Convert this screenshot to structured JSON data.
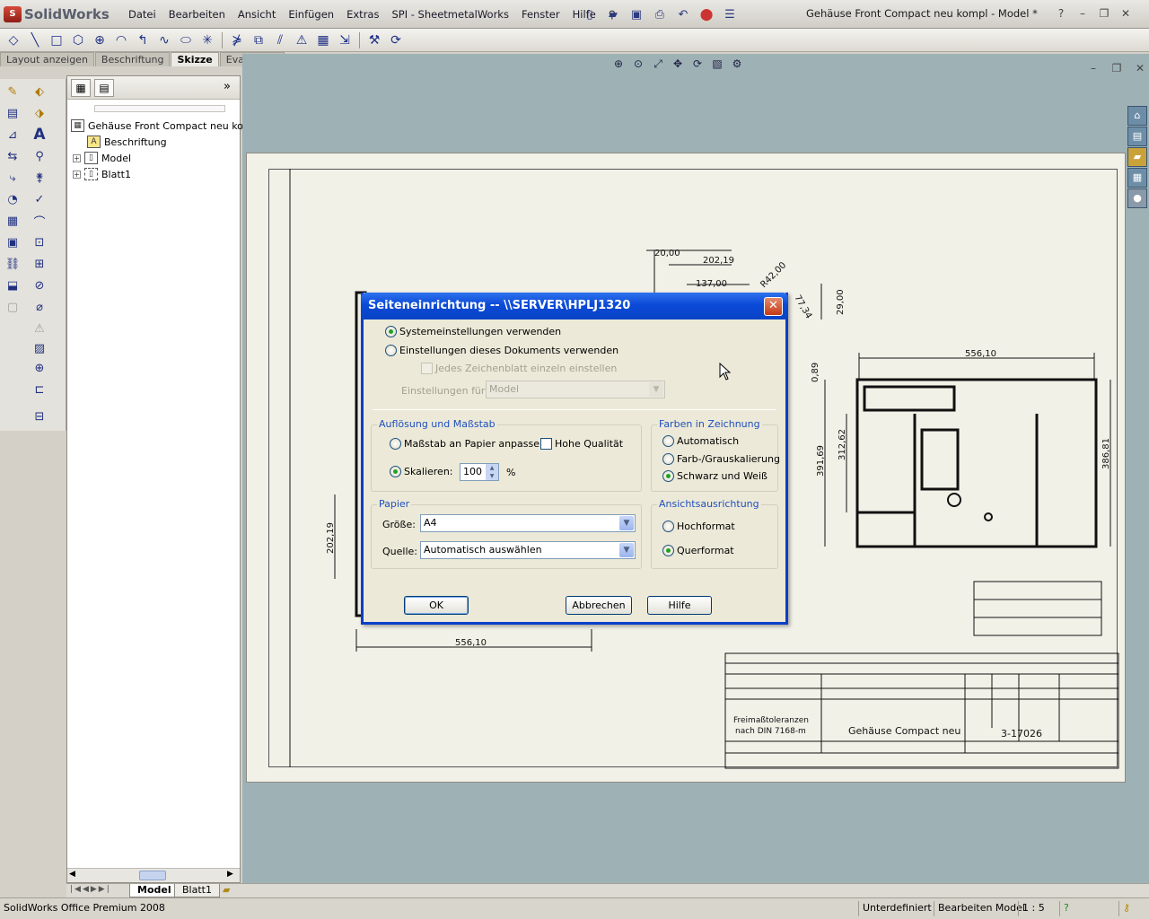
{
  "app": {
    "logo_text": "SolidWorks",
    "document_title": "Gehäuse Front Compact neu kompl - Model *"
  },
  "menu": [
    "Datei",
    "Bearbeiten",
    "Ansicht",
    "Einfügen",
    "Extras",
    "SPI - SheetmetalWorks",
    "Fenster",
    "Hilfe"
  ],
  "command_tabs": [
    {
      "label": "Layout anzeigen",
      "active": false
    },
    {
      "label": "Beschriftung",
      "active": false
    },
    {
      "label": "Skizze",
      "active": true
    },
    {
      "label": "Evaluieren",
      "active": false
    }
  ],
  "feature_tree": {
    "root": "Gehäuse Front Compact neu kompl",
    "items": [
      {
        "label": "Beschriftung",
        "expandable": false
      },
      {
        "label": "Model",
        "expandable": true
      },
      {
        "label": "Blatt1",
        "expandable": true
      }
    ]
  },
  "sheet_tabs": [
    "Model",
    "Blatt1"
  ],
  "status_bar": {
    "product": "SolidWorks Office Premium 2008",
    "state": "Unterdefiniert",
    "mode": "Bearbeiten Model",
    "scale": "1 : 5"
  },
  "drawing": {
    "dims": [
      "20,00",
      "202,19",
      "137,00",
      "R42,00",
      "29,00",
      "77,34",
      "0,89",
      "556,10",
      "391,69",
      "312,62",
      "386,81",
      "202,19",
      "556,10"
    ],
    "title_block": {
      "part_name": "Gehäuse Compact neu",
      "drawing_no": "3-17026",
      "tolerance_line1": "Freimaßtoleranzen",
      "tolerance_line2": "nach DIN 7168-m"
    }
  },
  "dialog": {
    "title": "Seiteneinrichtung -- \\\\SERVER\\HPLJ1320",
    "opt_system": "Systemeinstellungen verwenden",
    "opt_document": "Einstellungen dieses Dokuments verwenden",
    "opt_each_sheet": "Jedes Zeichenblatt einzeln einstellen",
    "settings_for_label": "Einstellungen für:",
    "settings_for_value": "Model",
    "resolution": {
      "title": "Auflösung und Maßstab",
      "fit": "Maßstab an Papier anpassen",
      "high_quality": "Hohe Qualität",
      "scale": "Skalieren:",
      "scale_value": "100",
      "percent": "%"
    },
    "colors": {
      "title": "Farben in Zeichnung",
      "auto": "Automatisch",
      "color_gray": "Farb-/Grauskalierung",
      "bw": "Schwarz und Weiß"
    },
    "paper": {
      "title": "Papier",
      "size_label": "Größe:",
      "size_value": "A4",
      "source_label": "Quelle:",
      "source_value": "Automatisch auswählen"
    },
    "orientation": {
      "title": "Ansichtsausrichtung",
      "portrait": "Hochformat",
      "landscape": "Querformat"
    },
    "buttons": {
      "ok": "OK",
      "cancel": "Abbrechen",
      "help": "Hilfe"
    }
  }
}
